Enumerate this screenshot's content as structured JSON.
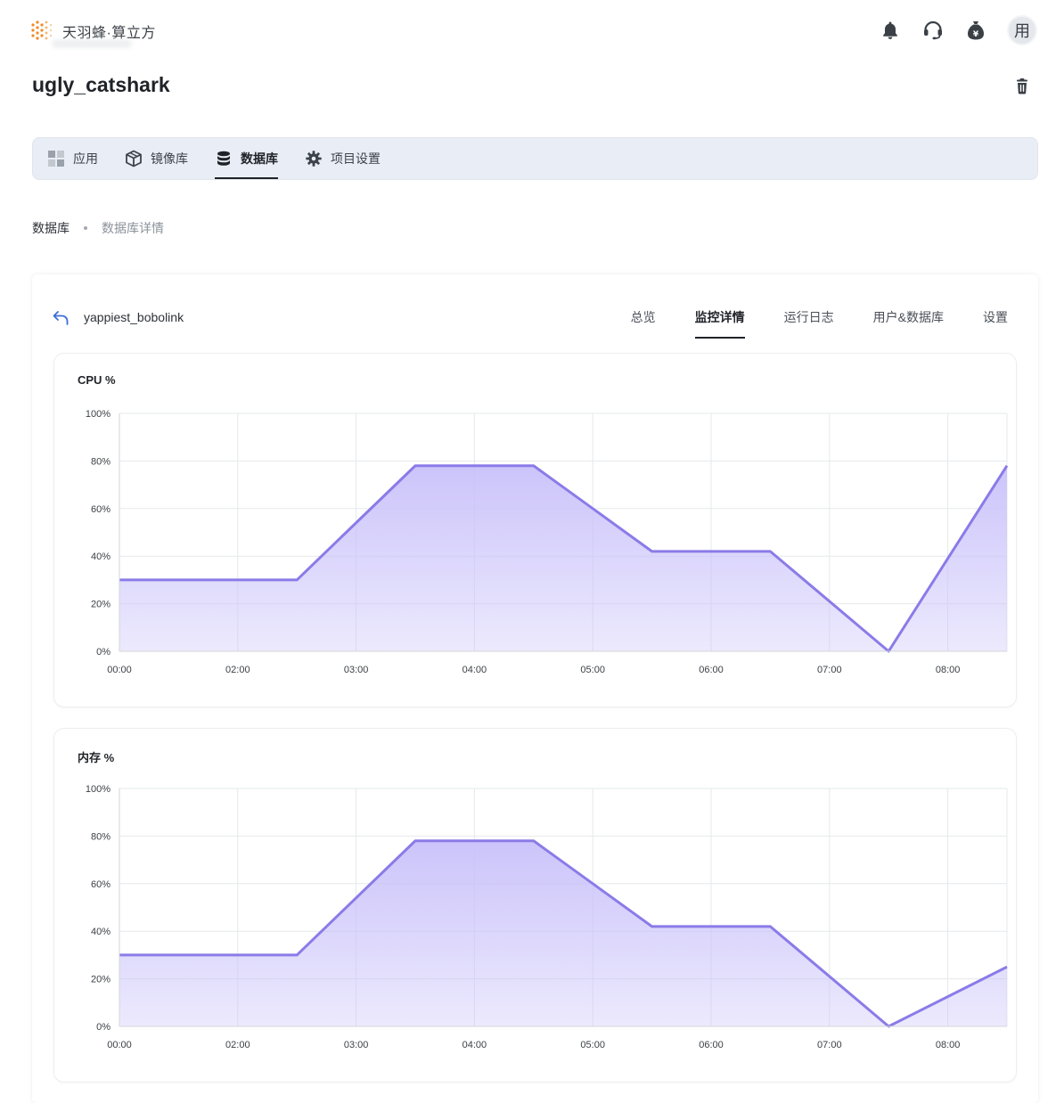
{
  "header": {
    "brand": "天羽蜂·算立方",
    "avatar_text": "用",
    "icons": [
      "bell-icon",
      "headset-icon",
      "money-bag-icon"
    ]
  },
  "project": {
    "title": "ugly_catshark"
  },
  "nav": {
    "items": [
      {
        "label": "应用",
        "icon": "apps-grid-icon"
      },
      {
        "label": "镜像库",
        "icon": "box-icon"
      },
      {
        "label": "数据库",
        "icon": "database-icon",
        "active": true
      },
      {
        "label": "项目设置",
        "icon": "gear-icon"
      }
    ]
  },
  "breadcrumb": {
    "root": "数据库",
    "current": "数据库详情"
  },
  "detail": {
    "name": "yappiest_bobolink",
    "tabs": [
      {
        "label": "总览"
      },
      {
        "label": "监控详情",
        "active": true
      },
      {
        "label": "运行日志"
      },
      {
        "label": "用户&数据库"
      },
      {
        "label": "设置"
      }
    ]
  },
  "colors": {
    "accent": "#8b7be8",
    "fill": "#c9c1fa"
  },
  "chart_data": [
    {
      "type": "area",
      "title": "CPU %",
      "x_ticks": [
        "00:00",
        "02:00",
        "03:00",
        "04:00",
        "05:00",
        "06:00",
        "07:00",
        "08:00"
      ],
      "y_ticks": [
        "100%",
        "80%",
        "60%",
        "40%",
        "20%",
        "0%"
      ],
      "ylim": [
        0,
        100
      ],
      "x": [
        0,
        1.5,
        2.5,
        3.5,
        4.5,
        5.5,
        6.5,
        7.5
      ],
      "values": [
        30,
        30,
        78,
        78,
        42,
        42,
        0,
        78
      ],
      "grid": true
    },
    {
      "type": "area",
      "title": "内存 %",
      "x_ticks": [
        "00:00",
        "02:00",
        "03:00",
        "04:00",
        "05:00",
        "06:00",
        "07:00",
        "08:00"
      ],
      "y_ticks": [
        "100%",
        "80%",
        "60%",
        "40%",
        "20%",
        "0%"
      ],
      "ylim": [
        0,
        100
      ],
      "x": [
        0,
        1.5,
        2.5,
        3.5,
        4.5,
        5.5,
        6.5,
        7.5
      ],
      "values": [
        30,
        30,
        78,
        78,
        42,
        42,
        0,
        25
      ],
      "grid": true
    }
  ]
}
